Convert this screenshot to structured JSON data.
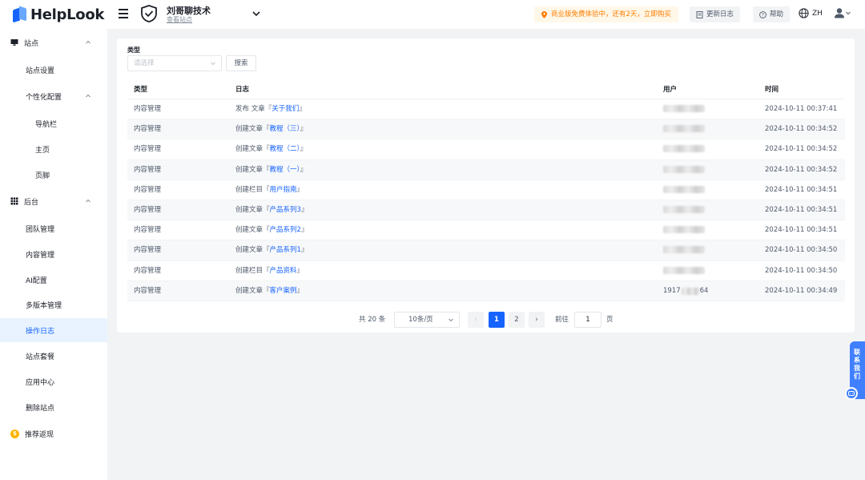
{
  "app": {
    "logo_text": "HelpLook"
  },
  "topbar": {
    "site_name": "刘哥聊技术",
    "site_link": "查看站点",
    "trial": "商业版免费体验中，还有2天，立即购买",
    "update_log": "更新日志",
    "help": "帮助",
    "lang": "ZH"
  },
  "sidebar": {
    "site": "站点",
    "site_settings": "站点设置",
    "personalize": "个性化配置",
    "navbar": "导航栏",
    "home": "主页",
    "footer": "页脚",
    "backend": "后台",
    "team": "团队管理",
    "content": "内容管理",
    "ai": "AI配置",
    "versions": "多版本管理",
    "oplog": "操作日志",
    "plan": "站点套餐",
    "apps": "应用中心",
    "delete": "删除站点",
    "referral": "推荐返现"
  },
  "filter": {
    "label": "类型",
    "placeholder": "请选择",
    "search": "搜索"
  },
  "table": {
    "headers": {
      "type": "类型",
      "log": "日志",
      "user": "用户",
      "time": "时间"
    },
    "rows": [
      {
        "type": "内容管理",
        "action": "发布 文章『",
        "target": "关于我们",
        "close": "』",
        "time": "2024-10-11 00:37:41"
      },
      {
        "type": "内容管理",
        "action": "创建文章『",
        "target": "教程（三）",
        "close": "』",
        "time": "2024-10-11 00:34:52"
      },
      {
        "type": "内容管理",
        "action": "创建文章『",
        "target": "教程（二）",
        "close": "』",
        "time": "2024-10-11 00:34:52"
      },
      {
        "type": "内容管理",
        "action": "创建文章『",
        "target": "教程（一）",
        "close": "』",
        "time": "2024-10-11 00:34:52"
      },
      {
        "type": "内容管理",
        "action": "创建栏目『",
        "target": "用户指南",
        "close": "』",
        "time": "2024-10-11 00:34:51"
      },
      {
        "type": "内容管理",
        "action": "创建文章『",
        "target": "产品系列3",
        "close": "』",
        "time": "2024-10-11 00:34:51"
      },
      {
        "type": "内容管理",
        "action": "创建文章『",
        "target": "产品系列2",
        "close": "』",
        "time": "2024-10-11 00:34:51"
      },
      {
        "type": "内容管理",
        "action": "创建文章『",
        "target": "产品系列1",
        "close": "』",
        "time": "2024-10-11 00:34:50"
      },
      {
        "type": "内容管理",
        "action": "创建栏目『",
        "target": "产品资料",
        "close": "』",
        "time": "2024-10-11 00:34:50"
      },
      {
        "type": "内容管理",
        "action": "创建文章『",
        "target": "客户案例",
        "close": "』",
        "time": "2024-10-11 00:34:49",
        "user_prefix": "1917",
        "user_suffix": "64"
      }
    ]
  },
  "pagination": {
    "total": "共 20 条",
    "page_size": "10条/页",
    "prev": "‹",
    "next": "›",
    "page1": "1",
    "page2": "2",
    "goto": "前往",
    "goto_value": "1",
    "goto_unit": "页"
  },
  "contact": {
    "label": "联系我们"
  },
  "colors": {
    "primary": "#1664ff",
    "warning": "#ff7d00",
    "active_bg": "#e8f3ff"
  }
}
